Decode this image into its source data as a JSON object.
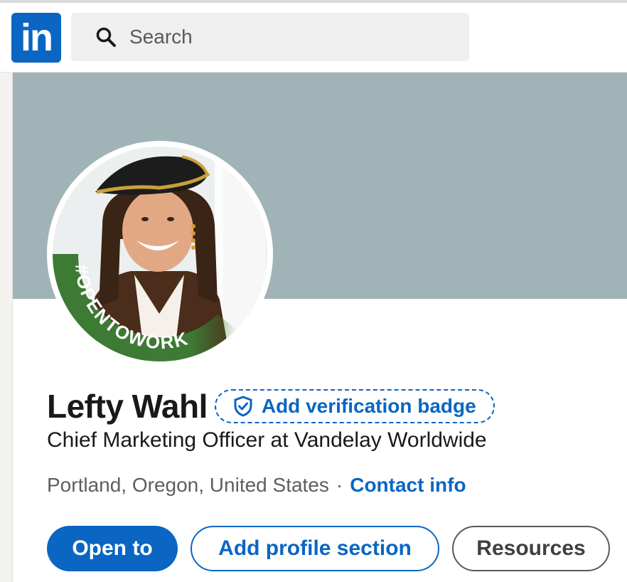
{
  "header": {
    "logo_text": "in",
    "search": {
      "placeholder": "Search",
      "icon": "search-icon"
    }
  },
  "profile": {
    "avatar_badge_text": "#OPENTOWORK",
    "name": "Lefty Wahl",
    "verification_label": "Add verification badge",
    "verification_icon": "shield-check-icon",
    "headline": "Chief Marketing Officer at Vandelay Worldwide",
    "location": "Portland, Oregon, United States",
    "separator": "·",
    "contact_label": "Contact info"
  },
  "actions": {
    "open_to": "Open to",
    "add_section": "Add profile section",
    "resources": "Resources"
  },
  "colors": {
    "brand_blue": "#0a66c2",
    "banner": "#a0b4b7",
    "open_to_work_green": "#3d7a34"
  }
}
